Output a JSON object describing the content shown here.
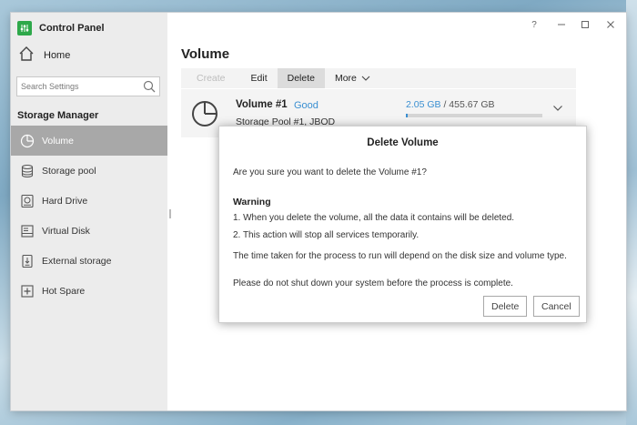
{
  "app": {
    "title": "Control Panel"
  },
  "window_controls": {
    "help": "?"
  },
  "sidebar": {
    "home_label": "Home",
    "search_placeholder": "Search Settings",
    "section_title": "Storage Manager",
    "items": [
      {
        "label": "Volume",
        "icon": "pie-chart-icon",
        "active": true
      },
      {
        "label": "Storage pool",
        "icon": "storage-pool-icon"
      },
      {
        "label": "Hard Drive",
        "icon": "hard-drive-icon"
      },
      {
        "label": "Virtual Disk",
        "icon": "virtual-disk-icon"
      },
      {
        "label": "External storage",
        "icon": "external-storage-icon"
      },
      {
        "label": "Hot Spare",
        "icon": "hot-spare-icon"
      }
    ]
  },
  "main": {
    "title": "Volume",
    "toolbar": {
      "create": "Create",
      "edit": "Edit",
      "delete": "Delete",
      "more": "More"
    },
    "volume": {
      "name": "Volume #1",
      "status": "Good",
      "pool": "Storage Pool #1, JBOD",
      "used": "2.05 GB",
      "separator": " / ",
      "total": "455.67 GB",
      "usage_fraction": 0.0045
    }
  },
  "dialog": {
    "title": "Delete Volume",
    "question": "Are you sure you want to delete the Volume #1?",
    "warning_title": "Warning",
    "warning_1": "1. When you delete the volume, all the data it contains will be deleted.",
    "warning_2": "2. This action will stop all services temporarily.",
    "note_1": "The time taken for the process to run will depend on the disk size and volume type.",
    "note_2": "Please do not shut down your system before the process is complete.",
    "delete_button": "Delete",
    "cancel_button": "Cancel"
  },
  "colors": {
    "accent": "#3a8fd1",
    "logo": "#2ea84a",
    "active_nav": "#a8a8a8"
  }
}
